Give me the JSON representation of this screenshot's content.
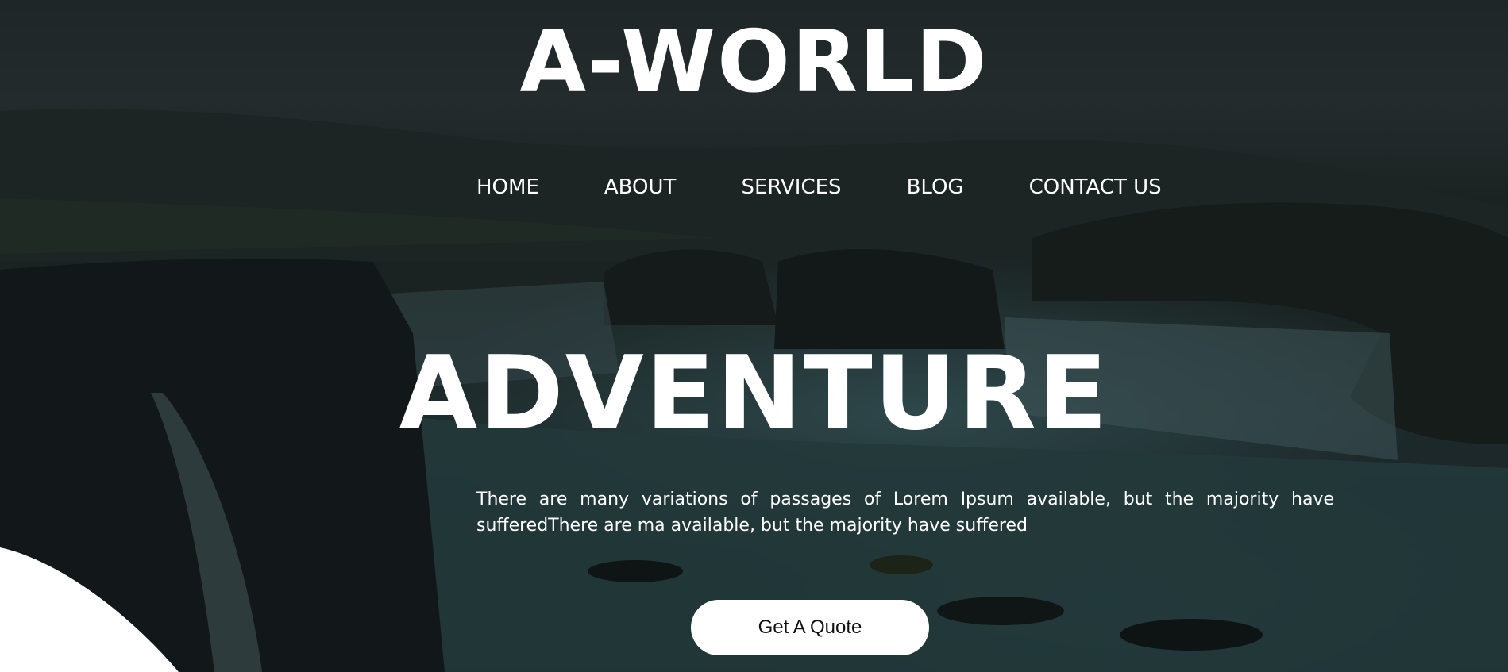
{
  "brand": {
    "title": "A-WORLD"
  },
  "nav": {
    "items": [
      {
        "label": "HOME"
      },
      {
        "label": "ABOUT"
      },
      {
        "label": "SERVICES"
      },
      {
        "label": "BLOG"
      },
      {
        "label": "CONTACT US"
      }
    ]
  },
  "hero": {
    "headline": "ADVENTURE",
    "description": "There are many variations of passages of Lorem Ipsum available, but the majority have sufferedThere are ma available, but the majority have suffered",
    "cta_label": "Get A Quote"
  },
  "colors": {
    "text": "#ffffff",
    "button_bg": "#ffffff",
    "button_text": "#111111",
    "overlay": "#1b2324"
  }
}
